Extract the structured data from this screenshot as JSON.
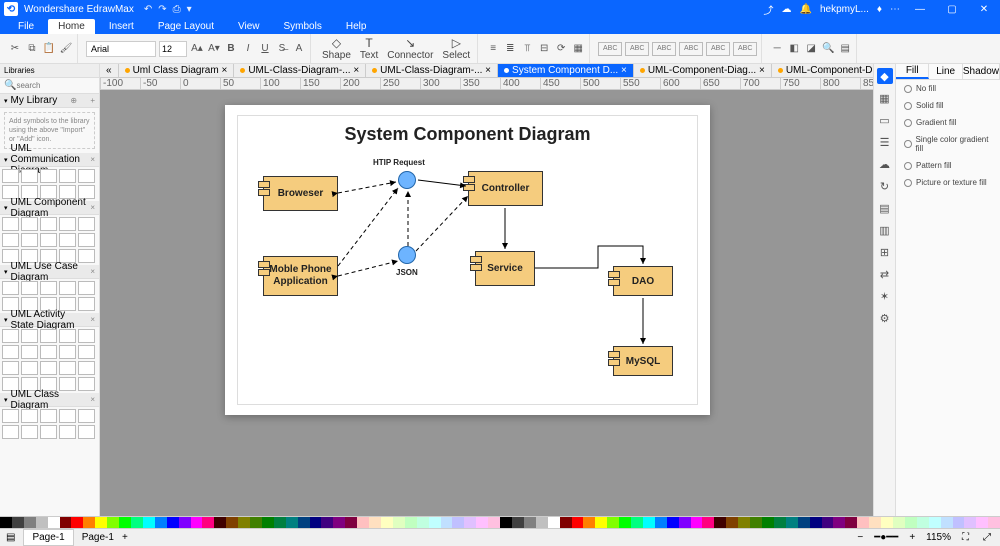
{
  "app": {
    "title": "Wondershare EdrawMax"
  },
  "menu": {
    "items": [
      "File",
      "Home",
      "Insert",
      "Page Layout",
      "View",
      "Symbols",
      "Help"
    ],
    "active": 1
  },
  "ribbon": {
    "font": "Arial",
    "size": "12",
    "tools": {
      "shape": "Shape",
      "text": "Text",
      "connector": "Connector",
      "select": "Select"
    }
  },
  "left": {
    "header": "Libraries",
    "search_ph": "search",
    "mylib": "My Library",
    "mylib_hint": "Add symbols to the library using the above \"Import\" or \"Add\" icon.",
    "sections": [
      "UML Communication Diagram",
      "UML Component Diagram",
      "UML Use Case Diagram",
      "UML Activity State Diagram",
      "UML Class Diagram"
    ]
  },
  "tabs": [
    {
      "label": "Uml Class Diagram ×"
    },
    {
      "label": "UML-Class-Diagram-... ×"
    },
    {
      "label": "UML-Class-Diagram-... ×"
    },
    {
      "label": "System Component D... ×"
    },
    {
      "label": "UML-Component-Diag... ×"
    },
    {
      "label": "UML-Component-Diag..."
    }
  ],
  "active_tab": 3,
  "diagram": {
    "title": "System Component Diagram",
    "nodes": {
      "browser": "Broweser",
      "mobile": "Moble Phone Application",
      "controller": "Controller",
      "service": "Service",
      "dao": "DAO",
      "mysql": "MySQL"
    },
    "labels": {
      "http": "HTIP Request",
      "json": "JSON"
    }
  },
  "right": {
    "tabs": [
      "Fill",
      "Line",
      "Shadow"
    ],
    "active": 0,
    "opts": [
      "No fill",
      "Solid fill",
      "Gradient fill",
      "Single color gradient fill",
      "Pattern fill",
      "Picture or texture fill"
    ]
  },
  "status": {
    "page": "Page-1",
    "zoom": "115%",
    "user": "hekpmyL..."
  },
  "colors": [
    "#000",
    "#404040",
    "#808080",
    "#c0c0c0",
    "#fff",
    "#800000",
    "#f00",
    "#ff8000",
    "#ff0",
    "#80ff00",
    "#0f0",
    "#00ff80",
    "#0ff",
    "#0080ff",
    "#00f",
    "#8000ff",
    "#f0f",
    "#ff0080",
    "#400000",
    "#804000",
    "#808000",
    "#408000",
    "#008000",
    "#008040",
    "#008080",
    "#004080",
    "#000080",
    "#400080",
    "#800080",
    "#800040",
    "#ffc0c0",
    "#ffe0c0",
    "#ffffc0",
    "#e0ffc0",
    "#c0ffc0",
    "#c0ffe0",
    "#c0ffff",
    "#c0e0ff",
    "#c0c0ff",
    "#e0c0ff",
    "#ffc0ff",
    "#ffc0e0"
  ]
}
